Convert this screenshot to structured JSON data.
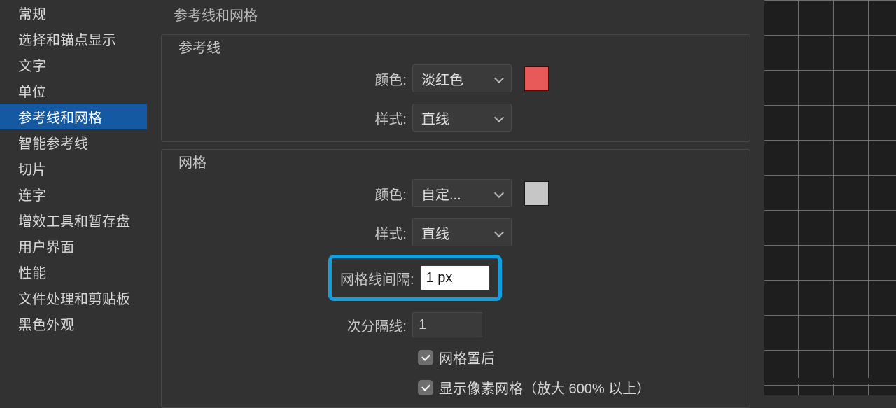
{
  "sidebar": {
    "items": [
      {
        "label": "常规"
      },
      {
        "label": "选择和锚点显示"
      },
      {
        "label": "文字"
      },
      {
        "label": "单位"
      },
      {
        "label": "参考线和网格"
      },
      {
        "label": "智能参考线"
      },
      {
        "label": "切片"
      },
      {
        "label": "连字"
      },
      {
        "label": "增效工具和暂存盘"
      },
      {
        "label": "用户界面"
      },
      {
        "label": "性能"
      },
      {
        "label": "文件处理和剪贴板"
      },
      {
        "label": "黑色外观"
      }
    ],
    "selected_index": 4
  },
  "content": {
    "page_title": "参考线和网格",
    "guides": {
      "legend": "参考线",
      "color_label": "颜色:",
      "color_value": "淡红色",
      "color_swatch": "#e85a5a",
      "style_label": "样式:",
      "style_value": "直线"
    },
    "grid": {
      "legend": "网格",
      "color_label": "颜色:",
      "color_value": "自定...",
      "color_swatch": "#c6c6c6",
      "style_label": "样式:",
      "style_value": "直线",
      "gridline_every_label": "网格线间隔:",
      "gridline_every_value": "1 px",
      "subdivisions_label": "次分隔线:",
      "subdivisions_value": "1",
      "grid_in_back_label": "网格置后",
      "show_pixel_grid_label": "显示像素网格（放大 600% 以上）"
    }
  }
}
